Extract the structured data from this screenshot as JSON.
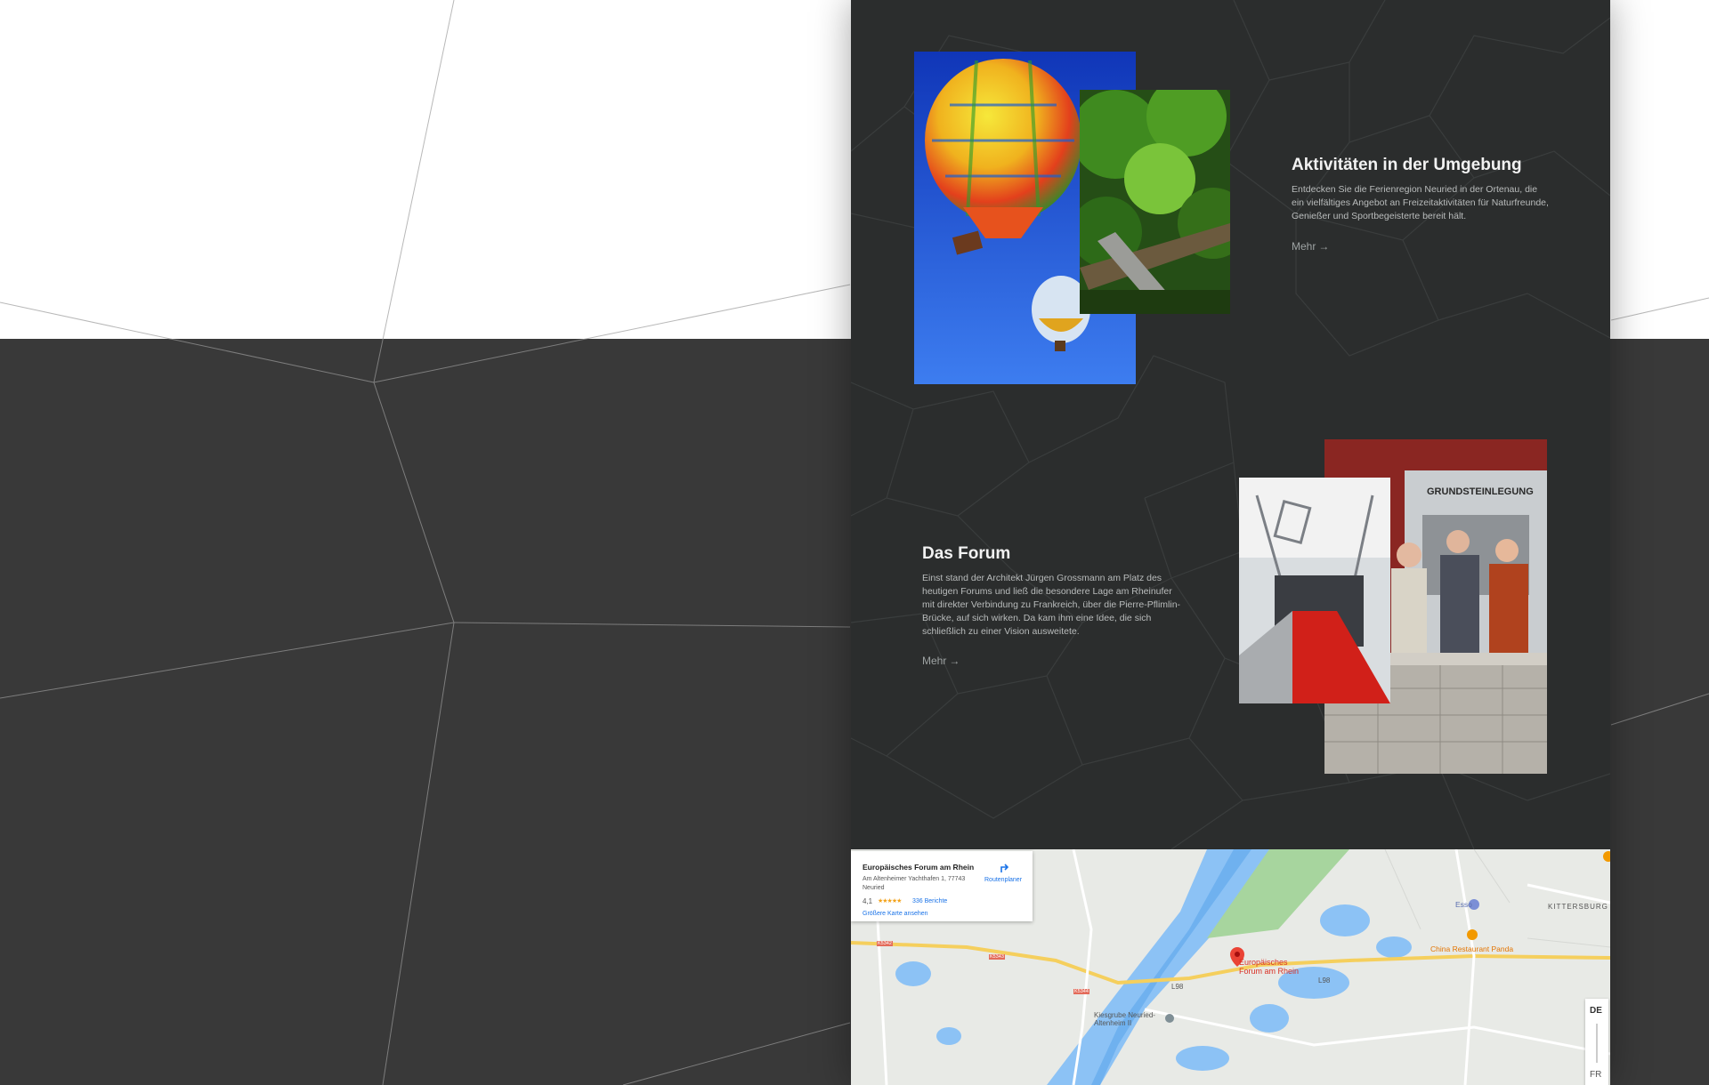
{
  "colors": {
    "page_bg": "#2b2d2d",
    "outer_dark": "#393939",
    "outer_light": "#ffffff",
    "title": "#f2f2f2",
    "text": "#b9bcbc",
    "link": "#9ea3a3"
  },
  "sections": [
    {
      "title": "Aktivitäten in der Umgebung",
      "text": "Entdecken Sie die Ferienregion Neuried in der Ortenau, die ein vielfältiges Angebot an Freizeitaktivitäten für Naturfreunde, Genießer und Sportbegeisterte bereit hält.",
      "more_label": "Mehr",
      "more_arrow": "→"
    },
    {
      "title": "Das Forum",
      "text": "Einst stand der Architekt Jürgen Grossmann am Platz des heutigen Forums und ließ die besondere Lage am Rheinufer mit direkter Verbindung zu Frankreich, über die Pierre-Pflimlin-Brücke, auf sich wirken. Da kam ihm eine Idee, die sich schließlich zu einer Vision ausweitete.",
      "more_label": "Mehr",
      "more_arrow": "→"
    }
  ],
  "images": {
    "photo_sign_text": "GRUNDSTEINLEGUNG"
  },
  "map": {
    "card": {
      "name": "Europäisches Forum am Rhein",
      "address": "Am Altenheimer Yachthafen 1, 77743 Neuried",
      "rating": "4,1",
      "stars": "★★★★★",
      "reviews": "336 Berichte",
      "bigger_map": "Größere Karte ansehen",
      "route": "Routenplaner"
    },
    "labels": {
      "place": "Europäisches Forum am Rhein",
      "kittersburg": "KITTERSBURG",
      "esso": "Esso",
      "china": "China Restaurant Panda",
      "kiesgrube": "Kiesgrube Neuried-Altenheim II",
      "road_l98": "L98",
      "road_l98b": "L98",
      "road_k5342": "K5342",
      "road_k5343": "K5343",
      "road_k5344": "K5344"
    },
    "lang_de": "DE",
    "lang_fr": "FR"
  }
}
